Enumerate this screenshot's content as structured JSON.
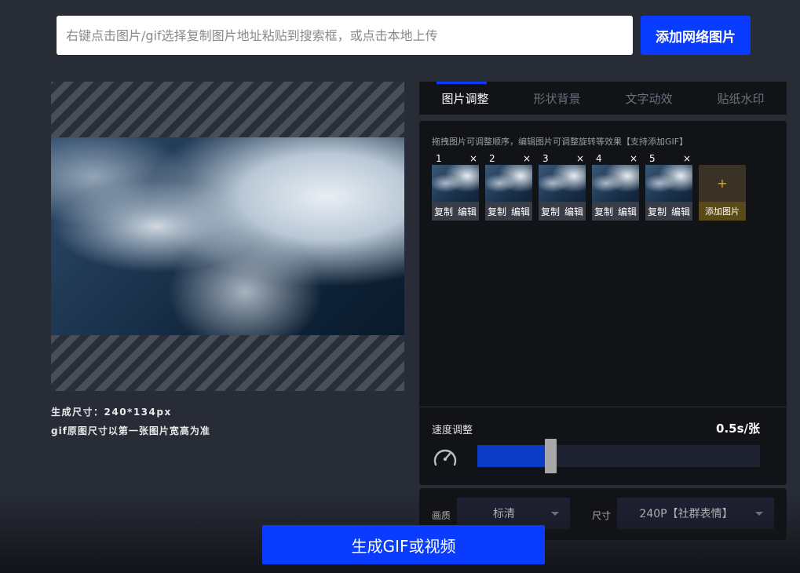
{
  "search": {
    "placeholder": "右键点击图片/gif选择复制图片地址粘贴到搜索框，或点击本地上传",
    "button_label": "添加网络图片"
  },
  "preview": {
    "size_text": "生成尺寸：240*134px",
    "size_note": "gif原图尺寸以第一张图片宽高为准"
  },
  "tabs": [
    {
      "label": "图片调整",
      "active": true
    },
    {
      "label": "形状背景",
      "active": false
    },
    {
      "label": "文字动效",
      "active": false
    },
    {
      "label": "贴纸水印",
      "active": false
    }
  ],
  "frames": {
    "tip": "拖拽图片可调整顺序，编辑图片可调整旋转等效果【支持添加GIF】",
    "items": [
      {
        "num": "1",
        "close": "×",
        "copy": "复制",
        "edit": "编辑"
      },
      {
        "num": "2",
        "close": "×",
        "copy": "复制",
        "edit": "编辑"
      },
      {
        "num": "3",
        "close": "×",
        "copy": "复制",
        "edit": "编辑"
      },
      {
        "num": "4",
        "close": "×",
        "copy": "复制",
        "edit": "编辑"
      },
      {
        "num": "5",
        "close": "×",
        "copy": "复制",
        "edit": "编辑"
      }
    ],
    "add_plus": "+",
    "add_label": "添加图片"
  },
  "speed": {
    "label": "速度调整",
    "value": "0.5s/张",
    "fill_fraction": 0.24
  },
  "settings": {
    "quality_label": "画质",
    "quality_value": "标清",
    "size_label": "尺寸",
    "size_value": "240P【社群表情】"
  },
  "generate": {
    "label": "生成GIF或视频"
  },
  "colors": {
    "accent": "#0a3cff",
    "background": "#282c36",
    "panel": "#121316",
    "add_frame": "#5a4a18"
  },
  "icons": {
    "speed": "speedometer-icon"
  }
}
